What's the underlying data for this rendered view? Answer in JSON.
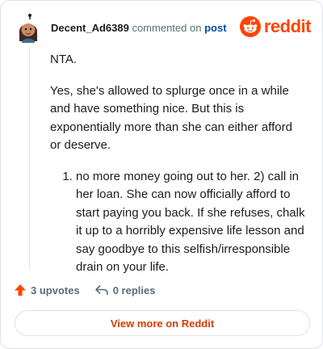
{
  "comment": {
    "author": "Decent_Ad6389",
    "action_text": "commented on",
    "link_text": "post",
    "brand_name": "reddit",
    "paragraphs": [
      "NTA.",
      "Yes, she's allowed to splurge once in a while and have something nice. But this is exponentially more than she can either afford or deserve."
    ],
    "list_items": [
      "no more money going out to her. 2) call in her loan. She can now officially afford to start paying you back. If she refuses, chalk it up to a horribly expensive life lesson and say goodbye to this selfish/irresponsible drain on your life."
    ]
  },
  "actions": {
    "upvotes_label": "3 upvotes",
    "replies_label": "0 replies"
  },
  "cta_label": "View more on Reddit",
  "icons": {
    "upvote": "upvote-arrow-icon",
    "reply": "reply-arrow-icon",
    "brand": "reddit-snoo-icon"
  },
  "colors": {
    "brand": "#ff4500",
    "cta_text": "#d93a00",
    "link": "#0a49b0",
    "muted": "#576f76"
  }
}
